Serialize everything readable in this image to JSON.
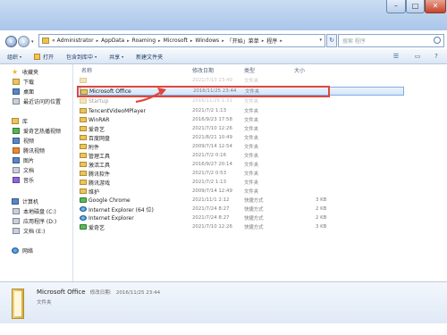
{
  "address_bar": {
    "overflow": "«",
    "crumbs": [
      "Administrator",
      "AppData",
      "Roaming",
      "Microsoft",
      "Windows",
      "「开始」菜单",
      "程序"
    ],
    "separator": "▸"
  },
  "search": {
    "placeholder": "搜索 程序"
  },
  "toolbar": {
    "organize": "组织",
    "open": "打开",
    "include_in_library": "包含到库中",
    "share": "共享",
    "new_folder": "新建文件夹"
  },
  "sidebar": {
    "favorites": "收藏夹",
    "downloads": "下载",
    "desktop": "桌面",
    "recent_places": "最近访问的位置",
    "libraries": "库",
    "lib_video_site": "爱奇艺热播视频",
    "lib_videos": "视频",
    "lib_tencent_video": "腾讯视频",
    "lib_pictures": "图片",
    "lib_documents": "文档",
    "lib_music": "音乐",
    "computer": "计算机",
    "drive_c": "本地磁盘 (C:)",
    "drive_d": "应用程序 (D:)",
    "drive_e": "文档 (E:)",
    "network": "网络"
  },
  "columns": {
    "name": "名称",
    "date": "修改日期",
    "type": "类型",
    "size": "大小"
  },
  "rows": [
    {
      "name": "",
      "date": "2021/7/13 23:49",
      "type": "文件夹",
      "size": ""
    },
    {
      "name": "Microsoft Office",
      "date": "2016/11/25 23:44",
      "type": "文件夹",
      "size": ""
    },
    {
      "name": "Startup",
      "date": "2016/11/25 1:31",
      "type": "文件夹",
      "size": ""
    },
    {
      "name": "TencentVideoMPlayer",
      "date": "2021/7/2 1:13",
      "type": "文件夹",
      "size": ""
    },
    {
      "name": "WinRAR",
      "date": "2016/9/23 17:58",
      "type": "文件夹",
      "size": ""
    },
    {
      "name": "爱奇艺",
      "date": "2021/7/10 12:26",
      "type": "文件夹",
      "size": ""
    },
    {
      "name": "百度网盘",
      "date": "2021/8/21 10:49",
      "type": "文件夹",
      "size": ""
    },
    {
      "name": "附件",
      "date": "2009/7/14 12:54",
      "type": "文件夹",
      "size": ""
    },
    {
      "name": "管理工具",
      "date": "2021/7/2 0:16",
      "type": "文件夹",
      "size": ""
    },
    {
      "name": "激活工具",
      "date": "2016/9/27 20:14",
      "type": "文件夹",
      "size": ""
    },
    {
      "name": "腾讯软件",
      "date": "2021/7/2 0:53",
      "type": "文件夹",
      "size": ""
    },
    {
      "name": "腾讯游戏",
      "date": "2021/7/2 1:13",
      "type": "文件夹",
      "size": ""
    },
    {
      "name": "维护",
      "date": "2009/7/14 12:49",
      "type": "文件夹",
      "size": ""
    },
    {
      "name": "Google Chrome",
      "date": "2021/11/1 2:12",
      "type": "快捷方式",
      "size": "3 KB"
    },
    {
      "name": "Internet Explorer (64 位)",
      "date": "2021/7/24 8:27",
      "type": "快捷方式",
      "size": "2 KB"
    },
    {
      "name": "Internet Explorer",
      "date": "2021/7/24 8:27",
      "type": "快捷方式",
      "size": "2 KB"
    },
    {
      "name": "爱奇艺",
      "date": "2021/7/10 12:26",
      "type": "快捷方式",
      "size": "3 KB"
    }
  ],
  "details": {
    "name": "Microsoft Office",
    "meta_label": "修改日期:",
    "meta_value": "2016/11/25 23:44",
    "type": "文件夹"
  },
  "colors": {
    "highlight": "#e0463c",
    "selection": "#d2e6fb"
  }
}
